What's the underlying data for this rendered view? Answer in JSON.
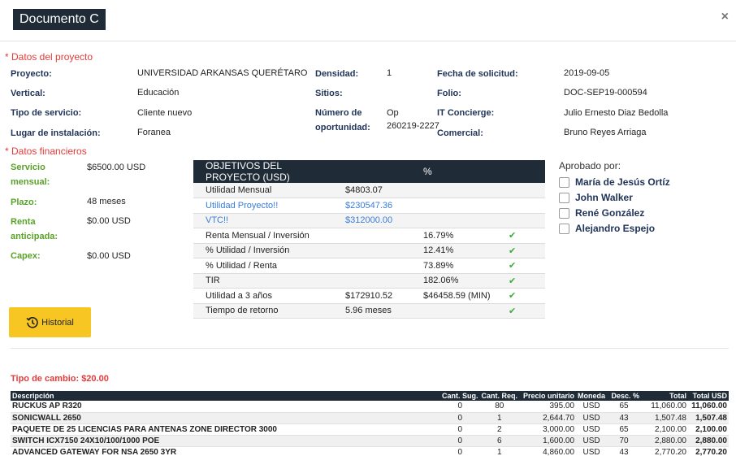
{
  "header": {
    "title": "Documento C",
    "close": "×"
  },
  "project": {
    "section_title": "* Datos del proyecto",
    "proyecto_label": "Proyecto:",
    "proyecto": "UNIVERSIDAD ARKANSAS QUERÉTARO",
    "vertical_label": "Vertical:",
    "vertical": "Educación",
    "tipo_label": "Tipo de servicio:",
    "tipo": "Cliente nuevo",
    "lugar_label": "Lugar de instalación:",
    "lugar": "Foranea",
    "densidad_label": "Densidad:",
    "densidad": "1",
    "sitios_label": "Sitios:",
    "sitios": "",
    "oportunidad_label_1": "Número de",
    "oportunidad_label_2": "oportunidad:",
    "oportunidad_1": "Op",
    "oportunidad_2": "260219-2227",
    "fecha_label": "Fecha de solicitud:",
    "fecha": "2019-09-05",
    "folio_label": "Folio:",
    "folio": "DOC-SEP19-000594",
    "it_label": "IT Concierge:",
    "it": "Julio Ernesto Diaz Bedolla",
    "comercial_label": "Comercial:",
    "comercial": "Bruno Reyes Arriaga"
  },
  "financial": {
    "section_title": "* Datos financieros",
    "servicio_label_1": "Servicio",
    "servicio_label_2": "mensual:",
    "servicio": "$6500.00 USD",
    "plazo_label": "Plazo:",
    "plazo": "48 meses",
    "renta_label_1": "Renta",
    "renta_label_2": "anticipada:",
    "renta": "$0.00 USD",
    "capex_label": "Capex:",
    "capex": "$0.00 USD"
  },
  "objectives": {
    "header": [
      "OBJETIVOS DEL PROYECTO (USD)",
      "",
      "%",
      ""
    ],
    "rows": [
      {
        "label": "Utilidad Mensual",
        "value": "$4803.07",
        "pct": "",
        "check": ""
      },
      {
        "label": "Utilidad Proyecto!!",
        "value": "$230547.36",
        "pct": "",
        "check": ""
      },
      {
        "label": "VTC!!",
        "value": "$312000.00",
        "pct": "",
        "check": ""
      },
      {
        "label": "Renta Mensual / Inversión",
        "value": "",
        "pct": "16.79%",
        "check": "✔"
      },
      {
        "label": "% Utilidad / Inversión",
        "value": "",
        "pct": "12.41%",
        "check": "✔"
      },
      {
        "label": "% Utilidad / Renta",
        "value": "",
        "pct": "73.89%",
        "check": "✔"
      },
      {
        "label": "TIR",
        "value": "",
        "pct": "182.06%",
        "check": "✔"
      },
      {
        "label": "Utilidad a 3 años",
        "value": "$172910.52",
        "pct": "$46458.59 (MIN)",
        "check": "✔"
      },
      {
        "label": "Tiempo de retorno",
        "value": "5.96 meses",
        "pct": "",
        "check": "✔"
      }
    ]
  },
  "approvals": {
    "title": "Aprobado por:",
    "names": [
      "María de Jesús Ortíz",
      "John Walker",
      "René González",
      "Alejandro Espejo"
    ]
  },
  "historial_label": "Historial",
  "tipo_cambio": "Tipo de cambio: $20.00",
  "items": {
    "headers": [
      "Descripción",
      "Cant. Sug.",
      "Cant. Req.",
      "Precio unitario",
      "Moneda",
      "Desc. %",
      "Total",
      "Total USD"
    ],
    "rows": [
      [
        "RUCKUS AP R320",
        "0",
        "80",
        "395.00",
        "USD",
        "65",
        "11,060.00",
        "11,060.00"
      ],
      [
        "SONICWALL 2650",
        "0",
        "1",
        "2,644.70",
        "USD",
        "43",
        "1,507.48",
        "1,507.48"
      ],
      [
        "PAQUETE DE 25 LICENCIAS PARA ANTENAS ZONE DIRECTOR 3000",
        "0",
        "2",
        "3,000.00",
        "USD",
        "65",
        "2,100.00",
        "2,100.00"
      ],
      [
        "SWITCH ICX7150 24X10/100/1000 POE",
        "0",
        "6",
        "1,600.00",
        "USD",
        "70",
        "2,880.00",
        "2,880.00"
      ],
      [
        "ADVANCED GATEWAY FOR NSA 2650 3YR",
        "0",
        "1",
        "4,860.00",
        "USD",
        "43",
        "2,770.20",
        "2,770.20"
      ]
    ]
  },
  "colors": {
    "accent_dark": "#1f2b36",
    "required_red": "#e53b3b",
    "label_blue": "#1f3358",
    "finance_green": "#5aa12a",
    "button_yellow": "#f7c623"
  }
}
